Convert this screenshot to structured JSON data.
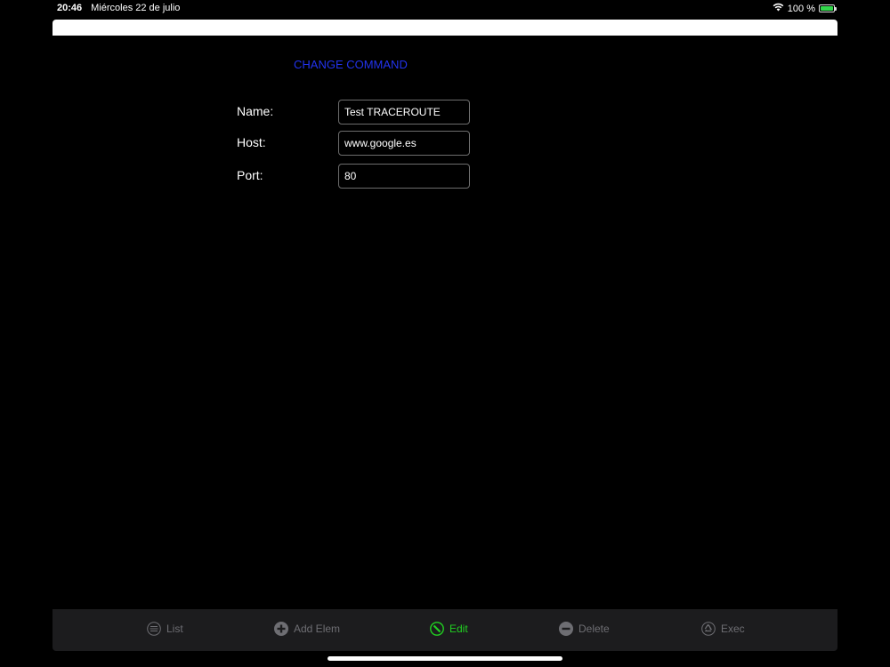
{
  "status_bar": {
    "time": "20:46",
    "date": "Miércoles 22 de julio",
    "battery_percent": "100 %"
  },
  "page": {
    "title": "CHANGE COMMAND"
  },
  "form": {
    "name_label": "Name:",
    "name_value": "Test TRACEROUTE",
    "host_label": "Host:",
    "host_value": "www.google.es",
    "port_label": "Port:",
    "port_value": "80"
  },
  "toolbar": {
    "items": [
      {
        "label": "List",
        "icon": "list-icon"
      },
      {
        "label": "Add Elem",
        "icon": "plus-circle-icon"
      },
      {
        "label": "Edit",
        "icon": "edit-icon",
        "active": true
      },
      {
        "label": "Delete",
        "icon": "minus-circle-icon"
      },
      {
        "label": "Exec",
        "icon": "recycle-icon"
      }
    ]
  },
  "colors": {
    "title": "#2233ee",
    "active_tool": "#21d021",
    "inactive_tool": "#6e6e73",
    "toolbar_bg": "#1c1c1e"
  }
}
